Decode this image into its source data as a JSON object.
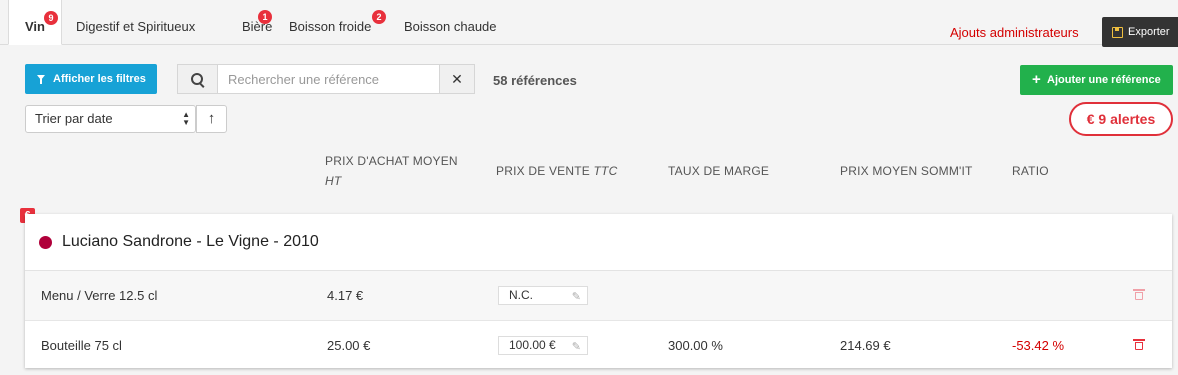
{
  "tabs": [
    {
      "label": "Vin",
      "badge": "9",
      "active": true
    },
    {
      "label": "Digestif et Spiritueux",
      "badge": ""
    },
    {
      "label": "Bière",
      "badge": "1"
    },
    {
      "label": "Boisson froide",
      "badge": "2"
    },
    {
      "label": "Boisson chaude",
      "badge": ""
    }
  ],
  "header": {
    "admin_link": "Ajouts administrateurs",
    "export_label": "Exporter"
  },
  "toolbar": {
    "filter_label": "Afficher les filtres",
    "search_placeholder": "Rechercher une référence",
    "search_value": "",
    "clear_symbol": "✕",
    "ref_count": "58 références",
    "add_label": "Ajouter une référence",
    "sort_value": "Trier par date",
    "sort_direction": "↑",
    "alerts_label": "€  9 alertes"
  },
  "columns": {
    "purchase": "PRIX D'ACHAT MOYEN",
    "purchase_unit": "HT",
    "sale": "PRIX DE VENTE",
    "sale_unit": "TTC",
    "margin": "TAUX DE MARGE",
    "somm": "PRIX MOYEN SOMM'IT",
    "ratio": "RATIO"
  },
  "product": {
    "alert_tag": "€",
    "name": "Luciano Sandrone - Le Vigne - 2010",
    "dot_color": "#b0003a",
    "rows": [
      {
        "format": "Menu / Verre 12.5 cl",
        "purchase": "4.17 €",
        "sale": "N.C.",
        "margin": "",
        "somm": "",
        "ratio": ""
      },
      {
        "format": "Bouteille 75 cl",
        "purchase": "25.00 €",
        "sale": "100.00 €",
        "margin": "300.00 %",
        "somm": "214.69 €",
        "ratio": "-53.42 %"
      }
    ]
  },
  "colors": {
    "accent_blue": "#17a2d6",
    "accent_green": "#22b14c",
    "alert_red": "#e0303a"
  }
}
